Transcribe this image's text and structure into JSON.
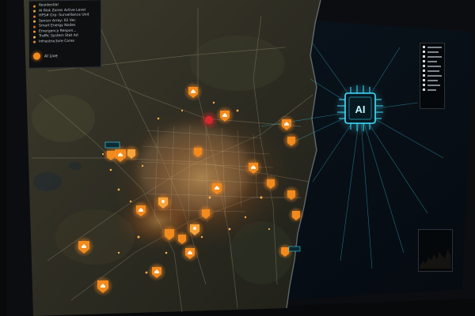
{
  "legend": {
    "items": [
      {
        "label": "Residential",
        "color": "#f28a1e"
      },
      {
        "label": "AI Risk Zones Active Level",
        "color": "#f2a43a"
      },
      {
        "label": "HPS# Grp: Surveillance Unit",
        "color": "#e47b23"
      },
      {
        "label": "Sensor Array: 02 Vec",
        "color": "#f0b24a"
      },
      {
        "label": "Smart Energy Nodes",
        "color": "#d96c1c"
      },
      {
        "label": "Emergency Respon...",
        "color": "#f38a2a"
      },
      {
        "label": "Traffic System Stat Ad",
        "color": "#f1b55c"
      },
      {
        "label": "Infrastructure Cores",
        "color": "#e9902d"
      }
    ],
    "footer_label": "AI Live"
  },
  "ai_badge": {
    "label": "AI",
    "color": "#3fe1ff"
  },
  "colors": {
    "accent_cyan": "#3fe1ff",
    "hotspot": "#ff8a1a",
    "alert_red": "#d9282b",
    "ocean": "#07111a"
  },
  "mini_chart": {
    "values": [
      0.2,
      0.35,
      0.25,
      0.55,
      0.4,
      0.7,
      0.45,
      0.8,
      0.6,
      0.5,
      0.9,
      0.65
    ]
  }
}
